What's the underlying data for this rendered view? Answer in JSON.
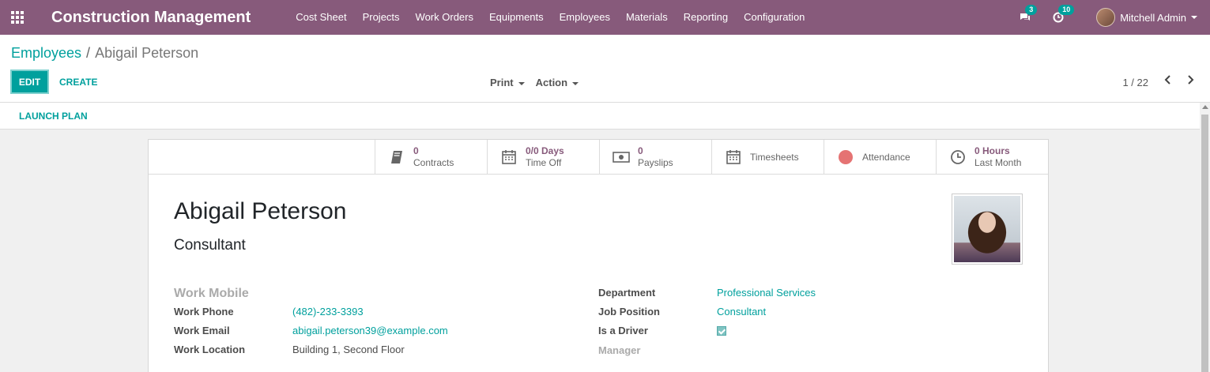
{
  "navbar": {
    "brand": "Construction Management",
    "menu": [
      "Cost Sheet",
      "Projects",
      "Work Orders",
      "Equipments",
      "Employees",
      "Materials",
      "Reporting",
      "Configuration"
    ],
    "messages_count": "3",
    "activities_count": "10",
    "user": "Mitchell Admin",
    "accent": "#875a7b"
  },
  "breadcrumb": {
    "parent": "Employees",
    "separator": "/",
    "current": "Abigail Peterson"
  },
  "toolbar": {
    "edit": "EDIT",
    "create": "CREATE",
    "print": "Print",
    "action": "Action",
    "pager": "1 / 22"
  },
  "statusbar": {
    "launch_plan": "LAUNCH PLAN"
  },
  "smart_buttons": [
    {
      "icon": "book-icon",
      "value": "0",
      "label": "Contracts"
    },
    {
      "icon": "calendar-icon",
      "value": "0/0 Days",
      "label": "Time Off"
    },
    {
      "icon": "money-icon",
      "value": "0",
      "label": "Payslips"
    },
    {
      "icon": "calendar-icon",
      "label": "Timesheets"
    },
    {
      "icon": "status-dot-icon",
      "label": "Attendance"
    },
    {
      "icon": "clock-icon",
      "value": "0 Hours",
      "label": "Last Month"
    }
  ],
  "employee": {
    "name": "Abigail Peterson",
    "job_title": "Consultant",
    "left_fields": [
      {
        "label": "Work Mobile",
        "value": ""
      },
      {
        "label": "Work Phone",
        "value": "(482)-233-3393"
      },
      {
        "label": "Work Email",
        "value": "abigail.peterson39@example.com"
      },
      {
        "label": "Work Location",
        "value": "Building 1, Second Floor"
      }
    ],
    "right_fields": [
      {
        "label": "Department",
        "value": "Professional Services"
      },
      {
        "label": "Job Position",
        "value": "Consultant"
      },
      {
        "label": "Is a Driver",
        "value": ""
      },
      {
        "label": "Manager",
        "value": ""
      }
    ]
  }
}
